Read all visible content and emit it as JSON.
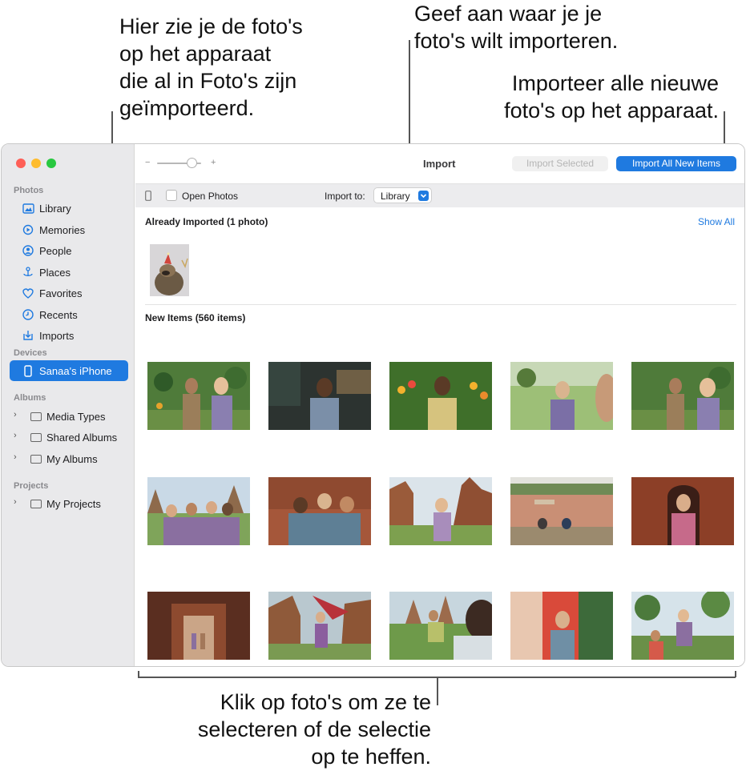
{
  "callouts": {
    "top_left": "Hier zie je de foto's\nop het apparaat\ndie al in Foto's zijn\ngeïmporteerd.",
    "top_center": "Geef aan waar je je\nfoto's wilt importeren.",
    "top_right": "Importeer alle nieuwe\nfoto's op het apparaat.",
    "bottom": "Klik op foto's om ze te\nselecteren of de selectie\nop te heffen."
  },
  "sidebar": {
    "sections": {
      "photos": "Photos",
      "devices": "Devices",
      "albums": "Albums",
      "projects": "Projects"
    },
    "photos_items": [
      {
        "label": "Library",
        "icon": "library-icon"
      },
      {
        "label": "Memories",
        "icon": "memories-icon"
      },
      {
        "label": "People",
        "icon": "people-icon"
      },
      {
        "label": "Places",
        "icon": "places-icon"
      },
      {
        "label": "Favorites",
        "icon": "heart-icon"
      },
      {
        "label": "Recents",
        "icon": "clock-icon"
      },
      {
        "label": "Imports",
        "icon": "imports-icon"
      }
    ],
    "device": "Sanaa's iPhone",
    "albums_items": [
      "Media Types",
      "Shared Albums",
      "My Albums"
    ],
    "projects_items": [
      "My Projects"
    ]
  },
  "toolbar": {
    "zoom_minus": "−",
    "zoom_plus": "+",
    "title": "Import",
    "import_selected": "Import Selected",
    "import_all": "Import All New Items"
  },
  "import_bar": {
    "open_photos": "Open Photos",
    "import_to_label": "Import to:",
    "import_to_value": "Library"
  },
  "already_imported": {
    "title": "Already Imported (1 photo)",
    "show_all": "Show All"
  },
  "new_items": {
    "title": "New Items (560 items)"
  },
  "colors": {
    "accent": "#1f7ae0",
    "close": "#fe5f57",
    "minimize": "#febc2e",
    "zoom": "#28c840",
    "sidebar_bg": "#e9e9eb"
  }
}
